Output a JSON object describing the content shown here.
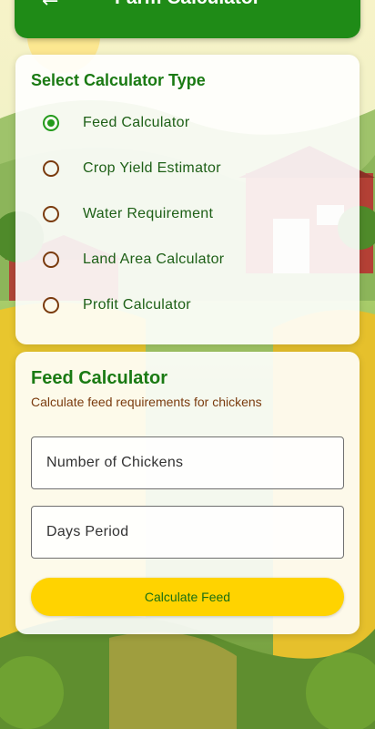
{
  "header": {
    "title": "Farm Calculator",
    "back_icon": "arrow-left-icon"
  },
  "calculator_type": {
    "title": "Select Calculator Type",
    "selected": "Feed Calculator",
    "options": [
      {
        "label": "Feed Calculator",
        "checked": true
      },
      {
        "label": "Crop Yield Estimator",
        "checked": false
      },
      {
        "label": "Water Requirement",
        "checked": false
      },
      {
        "label": "Land Area Calculator",
        "checked": false
      },
      {
        "label": "Profit Calculator",
        "checked": false
      }
    ]
  },
  "feed_calculator": {
    "title": "Feed Calculator",
    "subtitle": "Calculate feed requirements for chickens",
    "inputs": {
      "chickens_placeholder": "Number of Chickens",
      "days_placeholder": "Days Period"
    },
    "button_label": "Calculate Feed"
  },
  "colors": {
    "primary_green": "#1f8b17",
    "accent_yellow": "#ffd300",
    "radio_brown": "#7a3b0e"
  }
}
